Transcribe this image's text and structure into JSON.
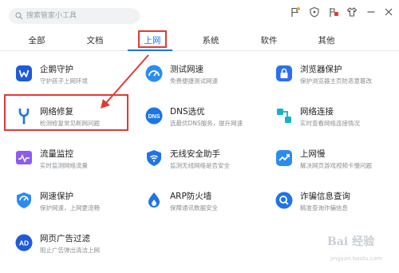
{
  "search": {
    "placeholder": "搜索管家小工具"
  },
  "toolbar_icons": [
    "flag-icon",
    "shield-icon",
    "user-flag-icon",
    "shirt-icon",
    "minimize-icon",
    "close-icon"
  ],
  "tabs": [
    {
      "label": "全部"
    },
    {
      "label": "文档"
    },
    {
      "label": "上网",
      "active": true
    },
    {
      "label": "系统"
    },
    {
      "label": "软件"
    },
    {
      "label": "其他"
    }
  ],
  "tools": [
    {
      "title": "企鹅守护",
      "desc": "守护孩子上网环境",
      "icon": "penguin-shield-icon"
    },
    {
      "title": "测试网速",
      "desc": "免费便捷测试网速",
      "icon": "speedometer-icon"
    },
    {
      "title": "浏览器保护",
      "desc": "保护浏览器主页防恶意篡改",
      "icon": "browser-lock-icon"
    },
    {
      "title": "网络修复",
      "desc": "检测修复常见断网问题",
      "icon": "network-repair-icon"
    },
    {
      "title": "DNS选优",
      "desc": "选最优DNS服务，提升网速",
      "icon": "dns-icon"
    },
    {
      "title": "网络连接",
      "desc": "实时查看网络连接情况",
      "icon": "network-connection-icon"
    },
    {
      "title": "流量监控",
      "desc": "实时监测网络流量",
      "icon": "traffic-monitor-icon"
    },
    {
      "title": "无线安全助手",
      "desc": "监测无线网络是否安全",
      "icon": "wifi-shield-icon"
    },
    {
      "title": "上网慢",
      "desc": "解决网页游戏视频卡慢问题",
      "icon": "slow-network-icon"
    },
    {
      "title": "网速保护",
      "desc": "保护网速，上网更流畅",
      "icon": "speed-protect-icon"
    },
    {
      "title": "ARP防火墙",
      "desc": "保障通讯数据安全",
      "icon": "arp-firewall-icon"
    },
    {
      "title": "诈骗信息查询",
      "desc": "精准查询诈骗信息",
      "icon": "fraud-search-icon"
    },
    {
      "title": "网页广告过滤",
      "desc": "阻止广告弹出清洁上网",
      "icon": "ad-filter-icon"
    }
  ],
  "colors": {
    "accent": "#1a73e8",
    "highlight": "#e53935"
  },
  "watermark": {
    "line1": "Bai 经验",
    "line2": "jingyan.baidu.com"
  }
}
